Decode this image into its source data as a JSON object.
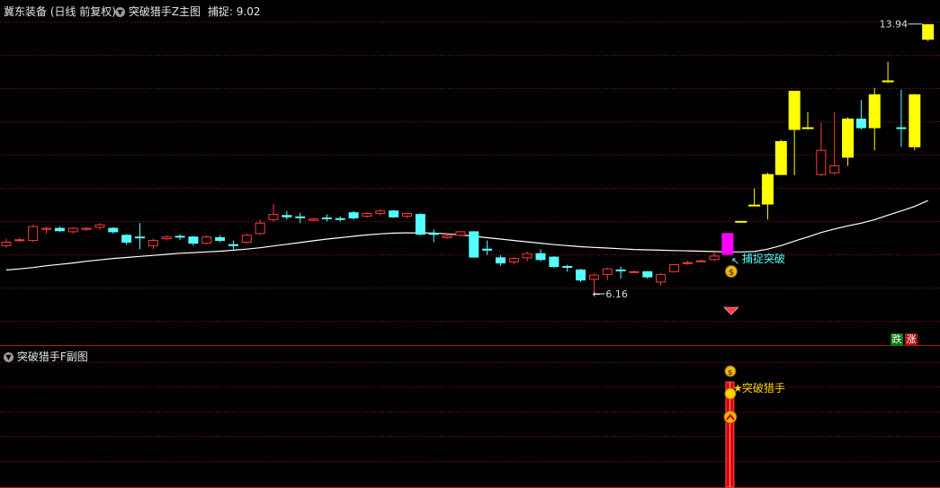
{
  "header": {
    "stock_title": "冀东装备 (日线 前复权)",
    "main_indicator": "突破猎手Z主图",
    "capture_label": "捕捉: 9.02"
  },
  "sub_panel": {
    "title": "突破猎手F副图",
    "signal_text": "突破猎手"
  },
  "annotations": {
    "high_price": "13.94",
    "low_price": "6.16",
    "breakout_label": "捕捉突破"
  },
  "badges": {
    "down": "跌",
    "up": "涨"
  },
  "colors": {
    "up_candle": "#ff3b3b",
    "down_candle": "#54ffff",
    "breakout_candle": "#ff00ff",
    "strong_candle": "#ffff00",
    "grid": "#7a1515",
    "ma_line": "#ffffff",
    "signal_bar": "#e00000"
  },
  "chart_data": {
    "type": "candlestick",
    "price_range_visible": [
      5.0,
      14.5
    ],
    "candles": [
      {
        "o": 7.55,
        "c": 7.65,
        "h": 7.75,
        "l": 7.5,
        "color": "red"
      },
      {
        "o": 7.7,
        "c": 7.72,
        "h": 7.78,
        "l": 7.65,
        "color": "red"
      },
      {
        "o": 7.7,
        "c": 8.1,
        "h": 8.15,
        "l": 7.65,
        "color": "red"
      },
      {
        "o": 8.02,
        "c": 8.05,
        "h": 8.1,
        "l": 7.9,
        "color": "red"
      },
      {
        "o": 8.05,
        "c": 7.98,
        "h": 8.1,
        "l": 7.95,
        "color": "cyan"
      },
      {
        "o": 7.95,
        "c": 8.05,
        "h": 8.08,
        "l": 7.9,
        "color": "red"
      },
      {
        "o": 8.02,
        "c": 8.05,
        "h": 8.08,
        "l": 7.98,
        "color": "red"
      },
      {
        "o": 8.08,
        "c": 8.15,
        "h": 8.2,
        "l": 8.0,
        "color": "red"
      },
      {
        "o": 8.05,
        "c": 7.95,
        "h": 8.08,
        "l": 7.9,
        "color": "cyan"
      },
      {
        "o": 7.85,
        "c": 7.65,
        "h": 7.88,
        "l": 7.58,
        "color": "cyan"
      },
      {
        "o": 7.8,
        "c": 7.78,
        "h": 8.2,
        "l": 7.45,
        "color": "cyan"
      },
      {
        "o": 7.55,
        "c": 7.7,
        "h": 7.75,
        "l": 7.45,
        "color": "red"
      },
      {
        "o": 7.75,
        "c": 7.8,
        "h": 7.85,
        "l": 7.7,
        "color": "red"
      },
      {
        "o": 7.8,
        "c": 7.82,
        "h": 7.88,
        "l": 7.72,
        "color": "cyan"
      },
      {
        "o": 7.8,
        "c": 7.62,
        "h": 7.82,
        "l": 7.55,
        "color": "cyan"
      },
      {
        "o": 7.62,
        "c": 7.8,
        "h": 7.85,
        "l": 7.58,
        "color": "red"
      },
      {
        "o": 7.78,
        "c": 7.7,
        "h": 7.85,
        "l": 7.65,
        "color": "cyan"
      },
      {
        "o": 7.55,
        "c": 7.58,
        "h": 7.7,
        "l": 7.45,
        "color": "cyan"
      },
      {
        "o": 7.65,
        "c": 7.85,
        "h": 7.9,
        "l": 7.6,
        "color": "red"
      },
      {
        "o": 7.9,
        "c": 8.2,
        "h": 8.3,
        "l": 7.85,
        "color": "red"
      },
      {
        "o": 8.3,
        "c": 8.45,
        "h": 8.75,
        "l": 8.25,
        "color": "red"
      },
      {
        "o": 8.42,
        "c": 8.38,
        "h": 8.55,
        "l": 8.3,
        "color": "cyan"
      },
      {
        "o": 8.38,
        "c": 8.36,
        "h": 8.5,
        "l": 8.2,
        "color": "cyan"
      },
      {
        "o": 8.32,
        "c": 8.28,
        "h": 8.35,
        "l": 8.25,
        "color": "red"
      },
      {
        "o": 8.35,
        "c": 8.33,
        "h": 8.45,
        "l": 8.25,
        "color": "cyan"
      },
      {
        "o": 8.33,
        "c": 8.32,
        "h": 8.4,
        "l": 8.25,
        "color": "cyan"
      },
      {
        "o": 8.35,
        "c": 8.5,
        "h": 8.55,
        "l": 8.3,
        "color": "cyan"
      },
      {
        "o": 8.4,
        "c": 8.48,
        "h": 8.52,
        "l": 8.35,
        "color": "red"
      },
      {
        "o": 8.48,
        "c": 8.55,
        "h": 8.6,
        "l": 8.42,
        "color": "red"
      },
      {
        "o": 8.55,
        "c": 8.38,
        "h": 8.58,
        "l": 8.35,
        "color": "cyan"
      },
      {
        "o": 8.4,
        "c": 8.48,
        "h": 8.5,
        "l": 8.35,
        "color": "red"
      },
      {
        "o": 8.45,
        "c": 7.88,
        "h": 8.48,
        "l": 7.85,
        "color": "cyan"
      },
      {
        "o": 7.9,
        "c": 7.88,
        "h": 8.02,
        "l": 7.65,
        "color": "cyan"
      },
      {
        "o": 7.78,
        "c": 7.83,
        "h": 7.92,
        "l": 7.75,
        "color": "red"
      },
      {
        "o": 7.85,
        "c": 7.95,
        "h": 7.97,
        "l": 7.8,
        "color": "red"
      },
      {
        "o": 7.95,
        "c": 7.22,
        "h": 7.97,
        "l": 7.2,
        "color": "cyan"
      },
      {
        "o": 7.45,
        "c": 7.42,
        "h": 7.7,
        "l": 7.28,
        "color": "cyan"
      },
      {
        "o": 7.2,
        "c": 7.05,
        "h": 7.28,
        "l": 6.97,
        "color": "cyan"
      },
      {
        "o": 7.08,
        "c": 7.18,
        "h": 7.22,
        "l": 7.02,
        "color": "red"
      },
      {
        "o": 7.2,
        "c": 7.32,
        "h": 7.38,
        "l": 7.1,
        "color": "red"
      },
      {
        "o": 7.32,
        "c": 7.15,
        "h": 7.45,
        "l": 7.1,
        "color": "cyan"
      },
      {
        "o": 7.22,
        "c": 6.95,
        "h": 7.25,
        "l": 6.9,
        "color": "cyan"
      },
      {
        "o": 6.95,
        "c": 6.93,
        "h": 7.0,
        "l": 6.8,
        "color": "cyan"
      },
      {
        "o": 6.85,
        "c": 6.56,
        "h": 6.88,
        "l": 6.5,
        "color": "cyan"
      },
      {
        "o": 6.58,
        "c": 6.7,
        "h": 6.75,
        "l": 6.16,
        "color": "red"
      },
      {
        "o": 6.72,
        "c": 6.88,
        "h": 6.92,
        "l": 6.55,
        "color": "red"
      },
      {
        "o": 6.85,
        "c": 6.84,
        "h": 6.95,
        "l": 6.6,
        "color": "cyan"
      },
      {
        "o": 6.8,
        "c": 6.79,
        "h": 6.83,
        "l": 6.76,
        "color": "red"
      },
      {
        "o": 6.8,
        "c": 6.65,
        "h": 6.82,
        "l": 6.6,
        "color": "cyan"
      },
      {
        "o": 6.5,
        "c": 6.72,
        "h": 6.75,
        "l": 6.4,
        "color": "red"
      },
      {
        "o": 6.8,
        "c": 7.0,
        "h": 7.02,
        "l": 6.78,
        "color": "red"
      },
      {
        "o": 7.05,
        "c": 7.06,
        "h": 7.12,
        "l": 7.0,
        "color": "red"
      },
      {
        "o": 7.1,
        "c": 7.11,
        "h": 7.15,
        "l": 7.08,
        "color": "red"
      },
      {
        "o": 7.15,
        "c": 7.25,
        "h": 7.35,
        "l": 7.1,
        "color": "red"
      },
      {
        "o": 7.3,
        "c": 7.9,
        "h": 7.92,
        "l": 7.28,
        "color": "magenta"
      },
      {
        "o": 8.25,
        "c": 8.24,
        "h": 8.26,
        "l": 8.24,
        "color": "yellow"
      },
      {
        "o": 8.72,
        "c": 8.71,
        "h": 9.2,
        "l": 8.7,
        "color": "yellow"
      },
      {
        "o": 8.75,
        "c": 9.6,
        "h": 9.65,
        "l": 8.3,
        "color": "yellow"
      },
      {
        "o": 9.6,
        "c": 10.55,
        "h": 10.6,
        "l": 9.6,
        "color": "yellow"
      },
      {
        "o": 10.9,
        "c": 12.0,
        "h": 12.0,
        "l": 9.58,
        "color": "yellow"
      },
      {
        "o": 10.95,
        "c": 10.94,
        "h": 11.4,
        "l": 10.9,
        "color": "yellow"
      },
      {
        "o": 9.6,
        "c": 10.3,
        "h": 11.1,
        "l": 9.55,
        "color": "red"
      },
      {
        "o": 9.65,
        "c": 9.85,
        "h": 11.4,
        "l": 9.6,
        "color": "red"
      },
      {
        "o": 10.1,
        "c": 11.2,
        "h": 11.25,
        "l": 9.85,
        "color": "yellow"
      },
      {
        "o": 11.2,
        "c": 10.95,
        "h": 11.75,
        "l": 10.9,
        "color": "cyan"
      },
      {
        "o": 10.95,
        "c": 11.9,
        "h": 12.1,
        "l": 10.3,
        "color": "yellow"
      },
      {
        "o": 12.3,
        "c": 12.29,
        "h": 12.85,
        "l": 12.25,
        "color": "yellow"
      },
      {
        "o": 10.95,
        "c": 10.94,
        "h": 12.05,
        "l": 10.4,
        "color": "cyan"
      },
      {
        "o": 10.4,
        "c": 11.9,
        "h": 11.92,
        "l": 10.3,
        "color": "yellow"
      },
      {
        "o": 13.5,
        "c": 13.92,
        "h": 13.94,
        "l": 13.45,
        "color": "yellow"
      }
    ],
    "ma": [
      6.85,
      6.88,
      6.92,
      6.97,
      7.01,
      7.05,
      7.1,
      7.14,
      7.18,
      7.21,
      7.24,
      7.27,
      7.3,
      7.33,
      7.35,
      7.37,
      7.39,
      7.42,
      7.45,
      7.49,
      7.54,
      7.59,
      7.64,
      7.69,
      7.74,
      7.78,
      7.82,
      7.86,
      7.89,
      7.91,
      7.92,
      7.92,
      7.91,
      7.89,
      7.86,
      7.82,
      7.78,
      7.74,
      7.7,
      7.66,
      7.62,
      7.58,
      7.55,
      7.52,
      7.5,
      7.48,
      7.46,
      7.44,
      7.43,
      7.42,
      7.41,
      7.4,
      7.39,
      7.38,
      7.37,
      7.37,
      7.38,
      7.45,
      7.55,
      7.68,
      7.8,
      7.93,
      8.03,
      8.12,
      8.2,
      8.3,
      8.43,
      8.55,
      8.68,
      8.85
    ]
  }
}
